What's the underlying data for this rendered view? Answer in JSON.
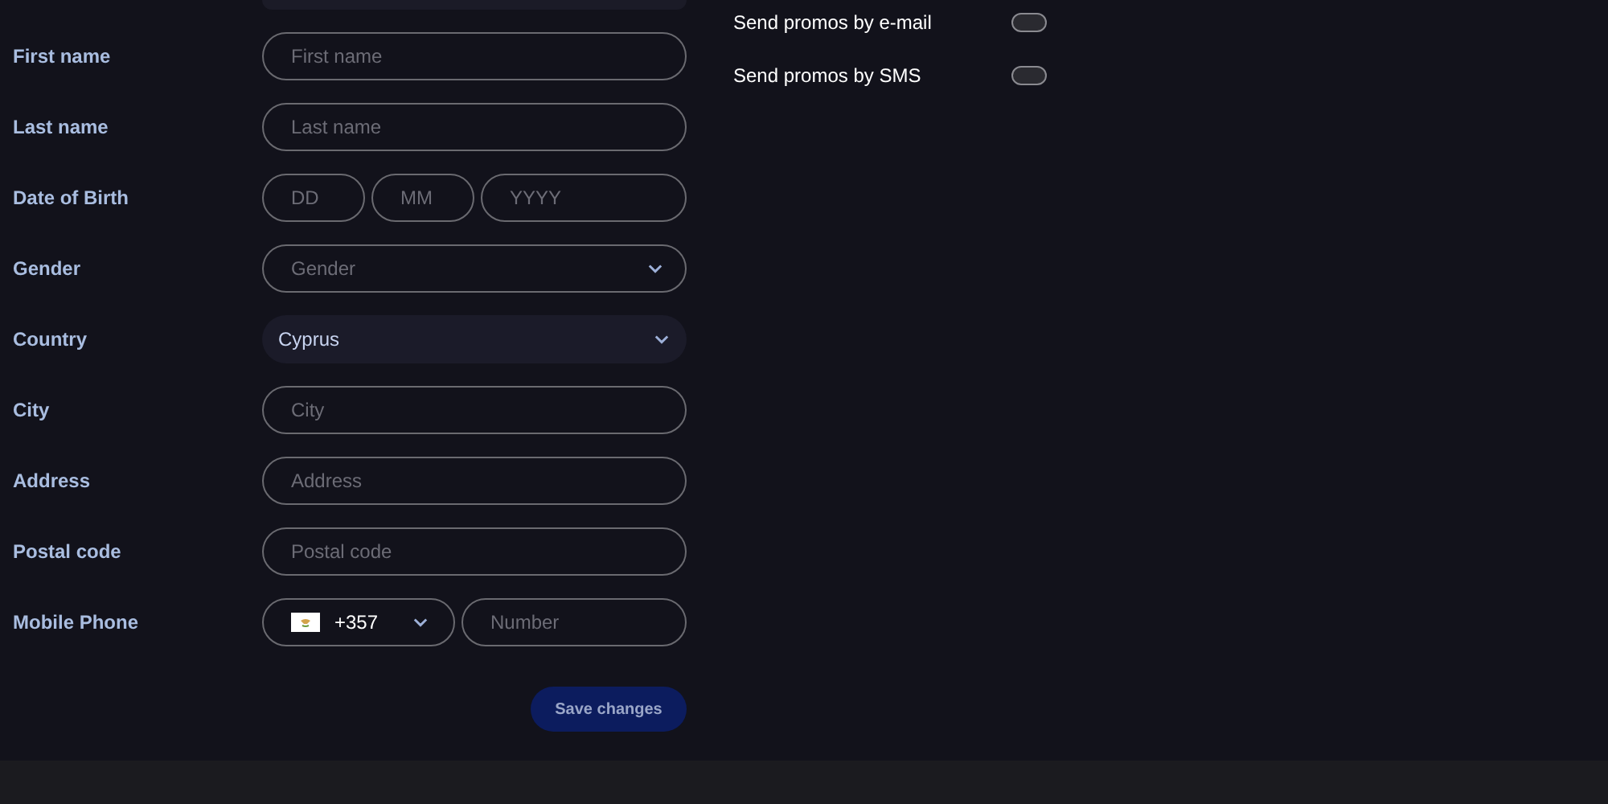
{
  "form": {
    "rows": [
      {
        "label": "First name",
        "kind": "text",
        "placeholder": "First name"
      },
      {
        "label": "Last name",
        "kind": "text",
        "placeholder": "Last name"
      },
      {
        "label": "Date of Birth",
        "kind": "date",
        "parts": [
          {
            "placeholder": "DD"
          },
          {
            "placeholder": "MM"
          },
          {
            "placeholder": "YYYY"
          }
        ]
      },
      {
        "label": "Gender",
        "kind": "select",
        "placeholder": "Gender"
      },
      {
        "label": "Country",
        "kind": "select",
        "value": "Cyprus"
      },
      {
        "label": "City",
        "kind": "text",
        "placeholder": "City"
      },
      {
        "label": "Address",
        "kind": "text",
        "placeholder": "Address"
      },
      {
        "label": "Postal code",
        "kind": "text",
        "placeholder": "Postal code"
      },
      {
        "label": "Mobile Phone",
        "kind": "phone",
        "code": "+357",
        "placeholder": "Number"
      }
    ],
    "save_button": "Save changes"
  },
  "promos": [
    {
      "label": "Send promos by e-mail",
      "on": false
    },
    {
      "label": "Send promos by SMS",
      "on": false
    }
  ]
}
